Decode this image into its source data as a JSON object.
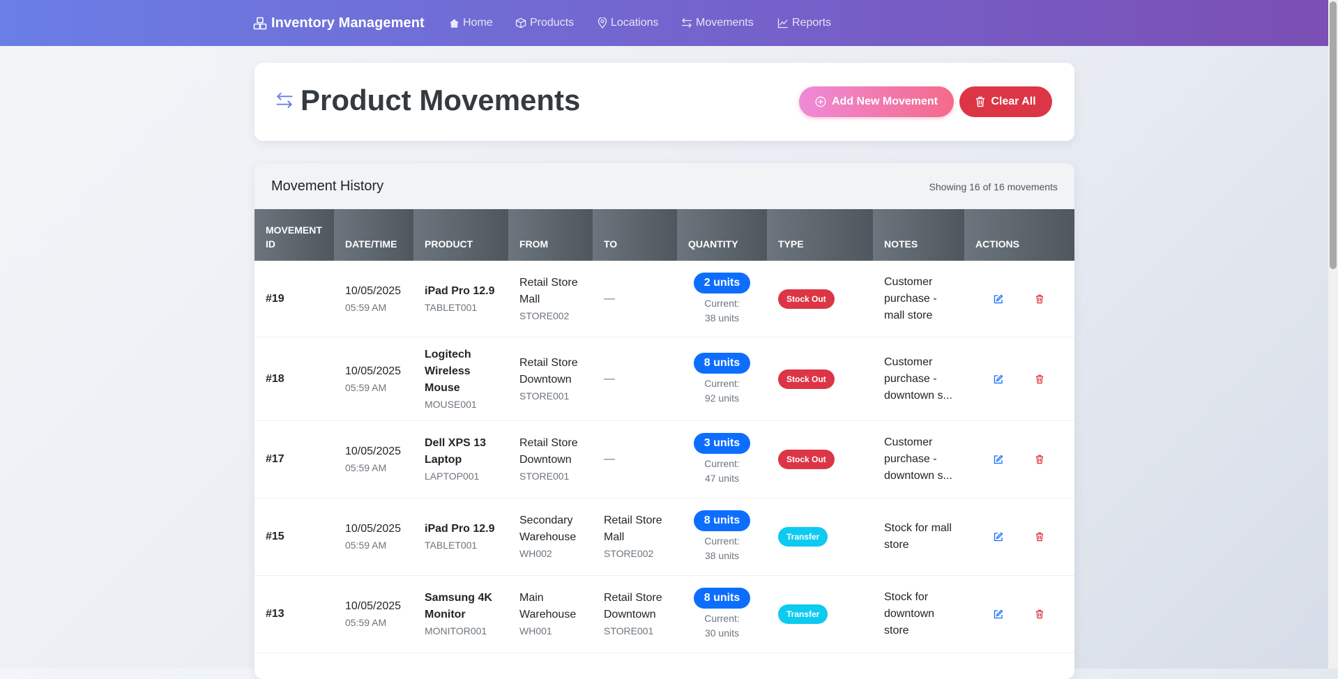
{
  "nav": {
    "brand": "Inventory Management",
    "links": [
      {
        "label": "Home",
        "icon": "house-icon"
      },
      {
        "label": "Products",
        "icon": "box-icon"
      },
      {
        "label": "Locations",
        "icon": "geo-pin-icon"
      },
      {
        "label": "Movements",
        "icon": "arrows-swap-icon"
      },
      {
        "label": "Reports",
        "icon": "chart-line-icon"
      }
    ]
  },
  "page": {
    "title": "Product Movements",
    "add_button": "Add New Movement",
    "clear_button": "Clear All"
  },
  "history": {
    "title": "Movement History",
    "count_text": "Showing 16 of 16 movements",
    "columns": [
      "MOVEMENT ID",
      "DATE/TIME",
      "PRODUCT",
      "FROM",
      "TO",
      "QUANTITY",
      "TYPE",
      "NOTES",
      "ACTIONS"
    ],
    "rows": [
      {
        "id": "#19",
        "date": "10/05/2025",
        "time": "05:59 AM",
        "product": "iPad Pro 12.9",
        "product_code": "TABLET001",
        "from": "Retail Store Mall",
        "from_code": "STORE002",
        "to": "—",
        "to_code": "",
        "qty": "2 units",
        "current": "Current: 38 units",
        "type": "Stock Out",
        "notes": "Customer purchase - mall store"
      },
      {
        "id": "#18",
        "date": "10/05/2025",
        "time": "05:59 AM",
        "product": "Logitech Wireless Mouse",
        "product_code": "MOUSE001",
        "from": "Retail Store Downtown",
        "from_code": "STORE001",
        "to": "—",
        "to_code": "",
        "qty": "8 units",
        "current": "Current: 92 units",
        "type": "Stock Out",
        "notes": "Customer purchase - downtown s..."
      },
      {
        "id": "#17",
        "date": "10/05/2025",
        "time": "05:59 AM",
        "product": "Dell XPS 13 Laptop",
        "product_code": "LAPTOP001",
        "from": "Retail Store Downtown",
        "from_code": "STORE001",
        "to": "—",
        "to_code": "",
        "qty": "3 units",
        "current": "Current: 47 units",
        "type": "Stock Out",
        "notes": "Customer purchase - downtown s..."
      },
      {
        "id": "#15",
        "date": "10/05/2025",
        "time": "05:59 AM",
        "product": "iPad Pro 12.9",
        "product_code": "TABLET001",
        "from": "Secondary Warehouse",
        "from_code": "WH002",
        "to": "Retail Store Mall",
        "to_code": "STORE002",
        "qty": "8 units",
        "current": "Current: 38 units",
        "type": "Transfer",
        "notes": "Stock for mall store"
      },
      {
        "id": "#13",
        "date": "10/05/2025",
        "time": "05:59 AM",
        "product": "Samsung 4K Monitor",
        "product_code": "MONITOR001",
        "from": "Main Warehouse",
        "from_code": "WH001",
        "to": "Retail Store Downtown",
        "to_code": "STORE001",
        "qty": "8 units",
        "current": "Current: 30 units",
        "type": "Transfer",
        "notes": "Stock for downtown store"
      }
    ]
  }
}
